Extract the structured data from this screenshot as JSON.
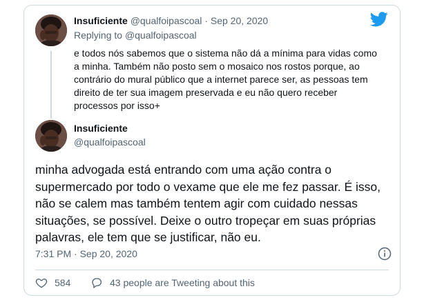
{
  "quoted": {
    "display_name": "Insuficiente",
    "handle": "@qualfoipascoal",
    "separator": "·",
    "date": "Sep 20, 2020",
    "replying_prefix": "Replying to",
    "replying_to": "@qualfoipascoal",
    "text": "e todos nós sabemos que o sistema não dá a mínima para vidas como a minha. Também não posto sem o mosaico nos rostos porque, ao contrário do mural público que a internet parece ser, as pessoas tem direito de ter sua imagem preservada e eu não quero receber processos por isso+"
  },
  "main": {
    "display_name": "Insuficiente",
    "handle": "@qualfoipascoal",
    "text": "minha advogada está entrando com uma ação contra o supermercado por todo o vexame que ele me fez passar. É isso, não se calem mas também tentem agir com cuidado nessas situações, se possível. Deixe o outro tropeçar em suas próprias palavras, ele tem que se justificar, não eu.",
    "timestamp": "7:31 PM · Sep 20, 2020"
  },
  "actions": {
    "likes": "584",
    "replies_text": "43 people are Tweeting about this"
  },
  "icons": {
    "brand": "twitter-bird-icon",
    "info": "info-icon",
    "like": "heart-icon",
    "reply": "speech-bubble-icon"
  },
  "colors": {
    "brand": "#1d9bf0",
    "text": "#0f1419",
    "secondary": "#536471",
    "border": "#cfd9de"
  }
}
